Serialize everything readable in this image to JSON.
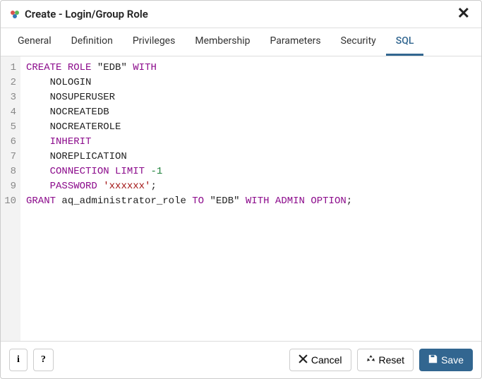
{
  "header": {
    "title": "Create - Login/Group Role"
  },
  "tabs": [
    {
      "label": "General",
      "active": false
    },
    {
      "label": "Definition",
      "active": false
    },
    {
      "label": "Privileges",
      "active": false
    },
    {
      "label": "Membership",
      "active": false
    },
    {
      "label": "Parameters",
      "active": false
    },
    {
      "label": "Security",
      "active": false
    },
    {
      "label": "SQL",
      "active": true
    }
  ],
  "sql": {
    "line_count": 10,
    "tokens": [
      [
        {
          "t": "CREATE",
          "c": "kw"
        },
        {
          "t": " "
        },
        {
          "t": "ROLE",
          "c": "kw"
        },
        {
          "t": " "
        },
        {
          "t": "\"EDB\"",
          "c": "ident"
        },
        {
          "t": " "
        },
        {
          "t": "WITH",
          "c": "kw"
        }
      ],
      [
        {
          "t": "    "
        },
        {
          "t": "NOLOGIN",
          "c": "ident"
        }
      ],
      [
        {
          "t": "    "
        },
        {
          "t": "NOSUPERUSER",
          "c": "ident"
        }
      ],
      [
        {
          "t": "    "
        },
        {
          "t": "NOCREATEDB",
          "c": "ident"
        }
      ],
      [
        {
          "t": "    "
        },
        {
          "t": "NOCREATEROLE",
          "c": "ident"
        }
      ],
      [
        {
          "t": "    "
        },
        {
          "t": "INHERIT",
          "c": "kw"
        }
      ],
      [
        {
          "t": "    "
        },
        {
          "t": "NOREPLICATION",
          "c": "ident"
        }
      ],
      [
        {
          "t": "    "
        },
        {
          "t": "CONNECTION",
          "c": "kw"
        },
        {
          "t": " "
        },
        {
          "t": "LIMIT",
          "c": "kw"
        },
        {
          "t": " "
        },
        {
          "t": "-1",
          "c": "num"
        }
      ],
      [
        {
          "t": "    "
        },
        {
          "t": "PASSWORD",
          "c": "kw"
        },
        {
          "t": " "
        },
        {
          "t": "'xxxxxx'",
          "c": "str"
        },
        {
          "t": ";",
          "c": "ident"
        }
      ],
      [
        {
          "t": "GRANT",
          "c": "kw"
        },
        {
          "t": " "
        },
        {
          "t": "aq_administrator_role",
          "c": "ident"
        },
        {
          "t": " "
        },
        {
          "t": "TO",
          "c": "kw"
        },
        {
          "t": " "
        },
        {
          "t": "\"EDB\"",
          "c": "ident"
        },
        {
          "t": " "
        },
        {
          "t": "WITH",
          "c": "kw"
        },
        {
          "t": " "
        },
        {
          "t": "ADMIN",
          "c": "kw"
        },
        {
          "t": " "
        },
        {
          "t": "OPTION",
          "c": "kw"
        },
        {
          "t": ";",
          "c": "ident"
        }
      ]
    ]
  },
  "footer": {
    "info_label": "i",
    "help_label": "?",
    "cancel_label": "Cancel",
    "reset_label": "Reset",
    "save_label": "Save"
  }
}
